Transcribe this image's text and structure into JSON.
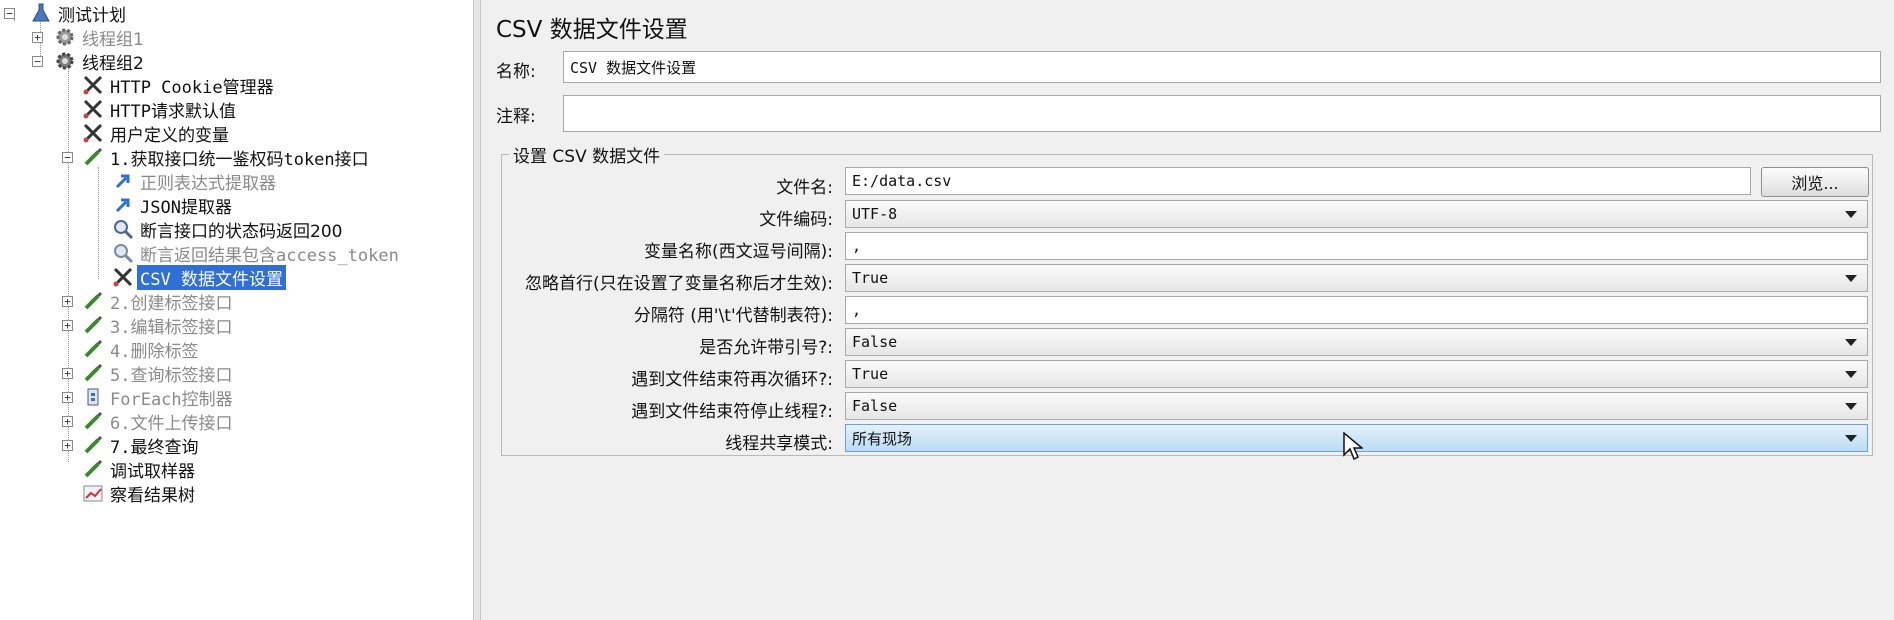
{
  "tree": {
    "nodes": [
      {
        "label": "测试计划",
        "icon": "flask-icon",
        "expander": "minus"
      },
      {
        "label": "线程组1",
        "icon": "gear-icon",
        "expander": "plus",
        "dim": true
      },
      {
        "label": "线程组2",
        "icon": "gear-icon",
        "expander": "minus"
      },
      {
        "label": "HTTP Cookie管理器",
        "icon": "wrench-scissors-icon"
      },
      {
        "label": "HTTP请求默认值",
        "icon": "wrench-scissors-icon"
      },
      {
        "label": "用户定义的变量",
        "icon": "wrench-scissors-icon"
      },
      {
        "label": "1.获取接口统一鉴权码token接口",
        "icon": "pipette-icon",
        "expander": "minus"
      },
      {
        "label": "正则表达式提取器",
        "icon": "arrow-icon",
        "dim": true
      },
      {
        "label": "JSON提取器",
        "icon": "arrow-icon"
      },
      {
        "label": "断言接口的状态码返回200",
        "icon": "magnifier-icon"
      },
      {
        "label": "断言返回结果包含access_token",
        "icon": "magnifier-icon",
        "dim": true
      },
      {
        "label": "CSV 数据文件设置",
        "icon": "wrench-scissors-icon",
        "selected": true
      },
      {
        "label": "2.创建标签接口",
        "icon": "pipette-icon",
        "expander": "plus",
        "dim": true
      },
      {
        "label": "3.编辑标签接口",
        "icon": "pipette-icon",
        "expander": "plus",
        "dim": true
      },
      {
        "label": "4.删除标签",
        "icon": "pipette-icon",
        "dim": true
      },
      {
        "label": "5.查询标签接口",
        "icon": "pipette-icon",
        "expander": "plus",
        "dim": true
      },
      {
        "label": "ForEach控制器",
        "icon": "controller-icon",
        "expander": "plus",
        "dim": true
      },
      {
        "label": "6.文件上传接口",
        "icon": "pipette-icon",
        "expander": "plus",
        "dim": true
      },
      {
        "label": "7.最终查询",
        "icon": "pipette-icon",
        "expander": "plus"
      },
      {
        "label": "调试取样器",
        "icon": "pipette-icon"
      },
      {
        "label": "察看结果树",
        "icon": "chart-icon"
      }
    ]
  },
  "panel": {
    "title": "CSV 数据文件设置",
    "name_label": "名称:",
    "name_value": "CSV 数据文件设置",
    "comment_label": "注释:",
    "comment_value": "",
    "group_title": "设置 CSV 数据文件",
    "browse_label": "浏览...",
    "fields": {
      "filename": {
        "label": "文件名:",
        "value": "E:/data.csv"
      },
      "encoding": {
        "label": "文件编码:",
        "value": "UTF-8"
      },
      "varnames": {
        "label": "变量名称(西文逗号间隔):",
        "value": ","
      },
      "ignore_first": {
        "label": "忽略首行(只在设置了变量名称后才生效):",
        "value": "True"
      },
      "delimiter": {
        "label": "分隔符 (用'\\t'代替制表符):",
        "value": ","
      },
      "quoted": {
        "label": "是否允许带引号?:",
        "value": "False"
      },
      "recycle": {
        "label": "遇到文件结束符再次循环?:",
        "value": "True"
      },
      "stop_thread": {
        "label": "遇到文件结束符停止线程?:",
        "value": "False"
      },
      "sharing": {
        "label": "线程共享模式:",
        "value": "所有现场"
      }
    }
  }
}
